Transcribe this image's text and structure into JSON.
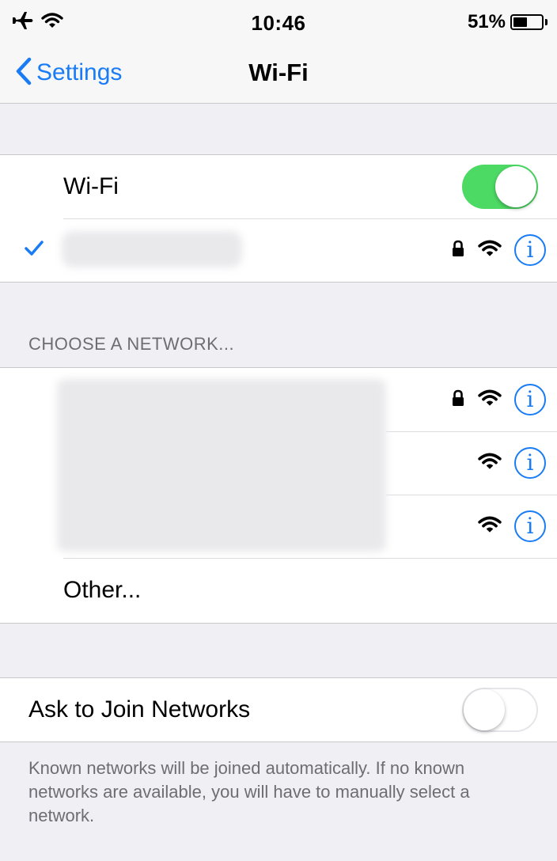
{
  "status_bar": {
    "time": "10:46",
    "battery_percent_label": "51%",
    "battery_level": 0.51,
    "icons": [
      "airplane-icon",
      "wifi-icon",
      "battery-icon"
    ]
  },
  "nav": {
    "back_label": "Settings",
    "title": "Wi-Fi"
  },
  "wifi_toggle": {
    "label": "Wi-Fi",
    "on": true
  },
  "connected_network": {
    "secured": true
  },
  "section_header": "CHOOSE A NETWORK...",
  "networks": [
    {
      "secured": true
    },
    {
      "secured": false
    },
    {
      "secured": false
    }
  ],
  "other_label": "Other...",
  "ask_to_join": {
    "label": "Ask to Join Networks",
    "on": false,
    "footer": "Known networks will be joined automatically. If no known networks are available, you will have to manually select a network."
  },
  "colors": {
    "accent": "#1a7cf5",
    "toggle_on": "#4cd964",
    "background": "#efeff4"
  }
}
